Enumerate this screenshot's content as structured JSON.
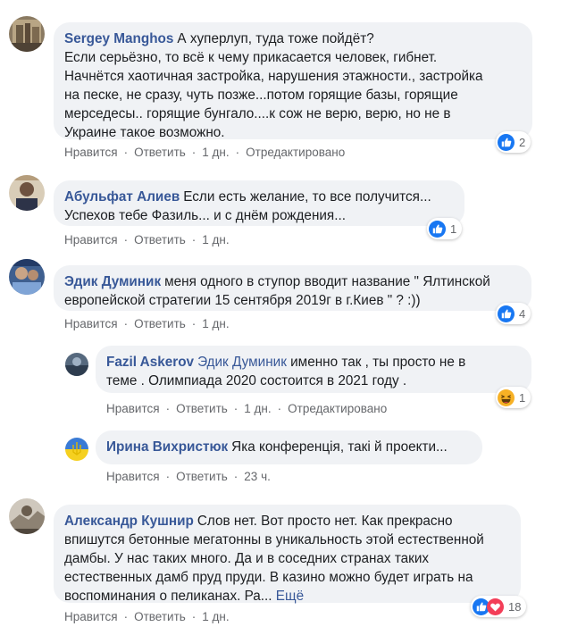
{
  "colors": {
    "bubble_bg": "#f0f2f5",
    "author": "#385898",
    "meta": "#65676b",
    "like_blue": "#1877f2",
    "love_red": "#f33e58",
    "haha_yellow": "#f7b125"
  },
  "comments": [
    {
      "author": "Sergey Manghos",
      "text_lines": [
        "А хуперлуп, туда тоже пойдёт?",
        "Если серьёзно, то всё к чему прикасается человек, гибнет.",
        "Начнётся хаотичная застройка, нарушения этажности., застройка",
        "на песке, не сразу, чуть позже...потом горящие базы, горящие",
        "мерседесы.. горящие бунгало....к сож не верю, верю, но не в",
        "Украине такое возможно."
      ],
      "like_label": "Нравится",
      "reply_label": "Ответить",
      "time": "1 дн.",
      "edited": "Отредактировано",
      "reactions": [
        "like-icon"
      ],
      "reaction_count": "2"
    },
    {
      "author": "Абульфат Алиев",
      "text_lines": [
        "Если есть желание, то все получится...",
        "Успехов тебе Фазиль... и с днём рождения..."
      ],
      "like_label": "Нравится",
      "reply_label": "Ответить",
      "time": "1 дн.",
      "reactions": [
        "like-icon"
      ],
      "reaction_count": "1"
    },
    {
      "author": "Эдик Думиник",
      "text_lines": [
        "меня одного в ступор вводит название \" Ялтинской",
        "европейской стратегии 15 сентября 2019г в г.Киев \" ? :))"
      ],
      "like_label": "Нравится",
      "reply_label": "Ответить",
      "time": "1 дн.",
      "reactions": [
        "like-icon"
      ],
      "reaction_count": "4"
    },
    {
      "author": "Fazil Askerov",
      "mention": "Эдик Думиник",
      "text_lines": [
        "именно так , ты просто не в",
        "теме . Олимпиада 2020 состоится в 2021 году ."
      ],
      "like_label": "Нравится",
      "reply_label": "Ответить",
      "time": "1 дн.",
      "edited": "Отредактировано",
      "reactions": [
        "haha-icon"
      ],
      "reaction_count": "1"
    },
    {
      "author": "Ирина Вихристюк",
      "text_lines": [
        "Яка конференція, такі й проекти..."
      ],
      "like_label": "Нравится",
      "reply_label": "Ответить",
      "time": "23 ч."
    },
    {
      "author": "Александр Кушнир",
      "text_lines": [
        "Слов нет. Вот просто нет. Как прекрасно",
        "впишутся бетонные мегатонны в уникальность этой естественной",
        "дамбы. У нас таких много. Да и в соседних странах таких",
        "естественных дамб пруд пруди. В казино можно будет играть на",
        "воспоминания о пеликанах. Ра..."
      ],
      "more_label": "Ещё",
      "like_label": "Нравится",
      "reply_label": "Ответить",
      "time": "1 дн.",
      "reactions": [
        "like-icon",
        "love-icon"
      ],
      "reaction_count": "18"
    }
  ]
}
